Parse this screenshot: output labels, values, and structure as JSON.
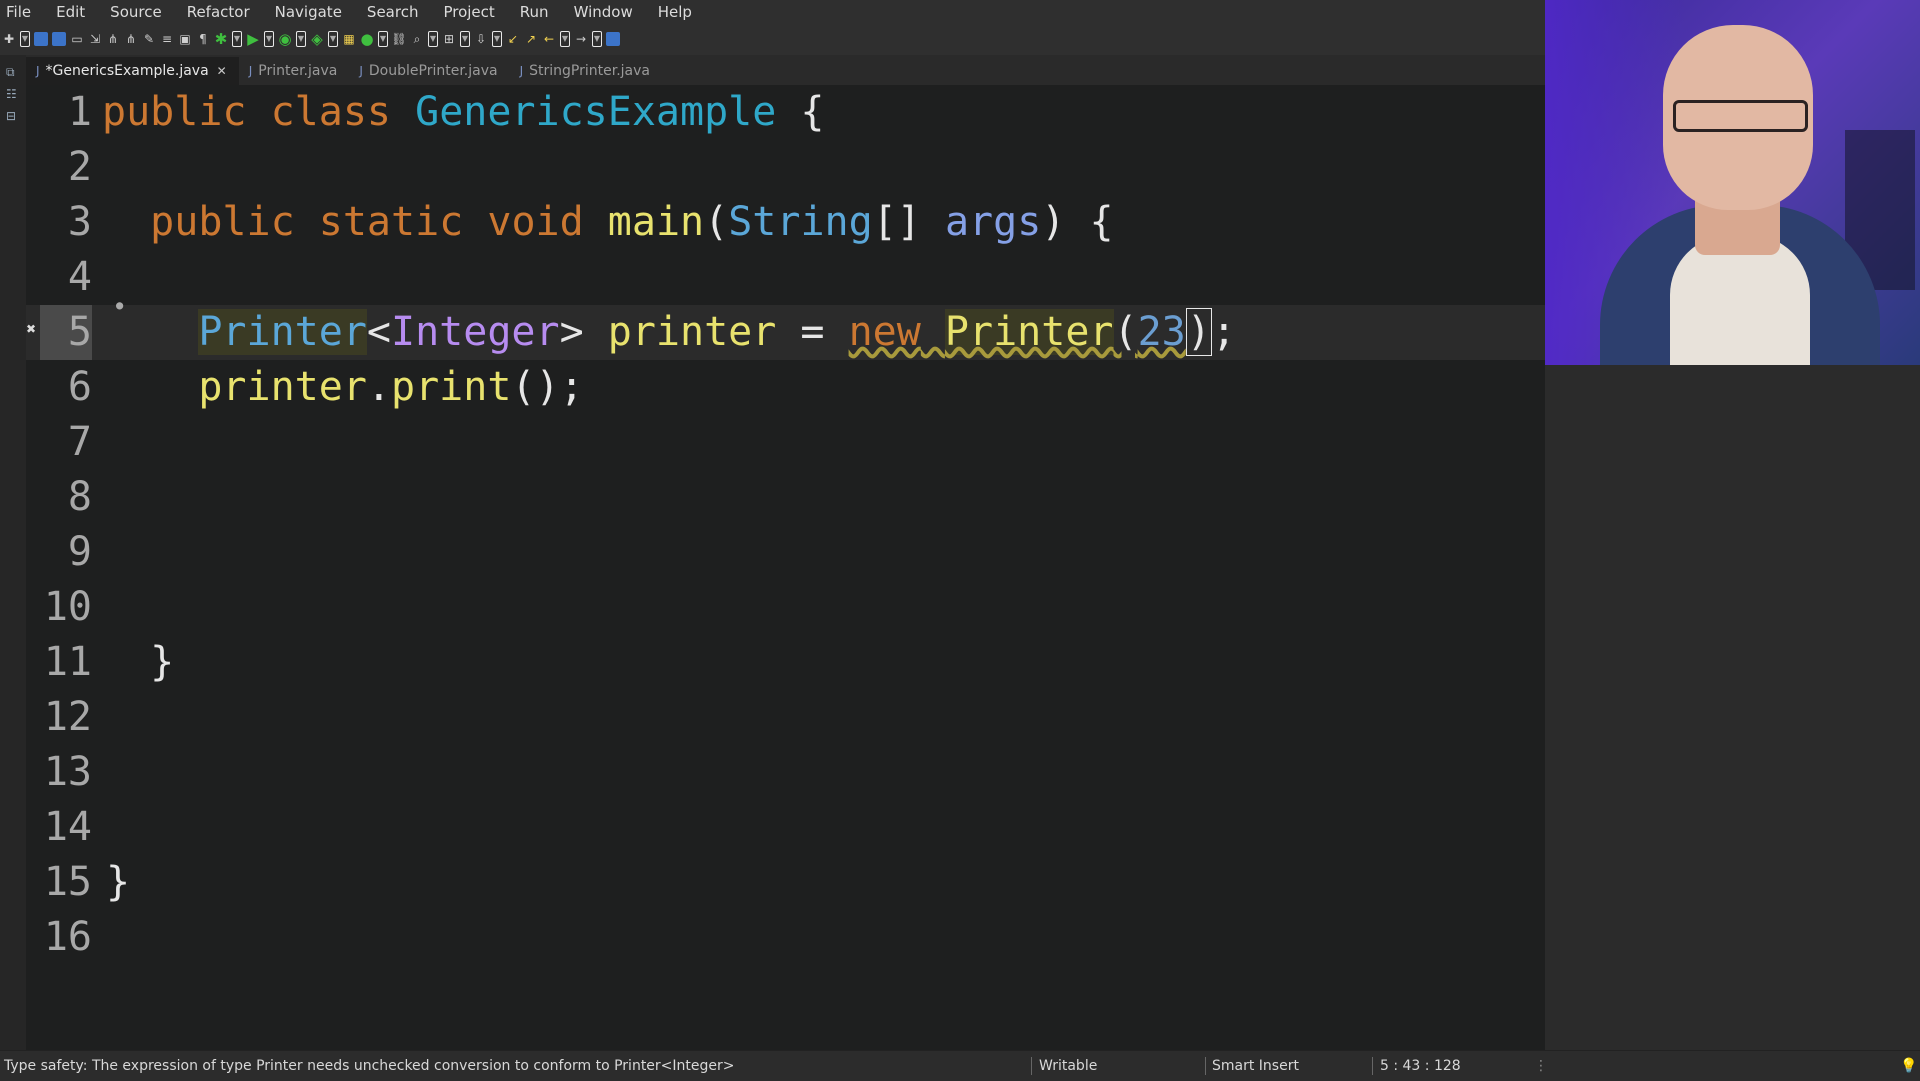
{
  "menu": [
    "File",
    "Edit",
    "Source",
    "Refactor",
    "Navigate",
    "Search",
    "Project",
    "Run",
    "Window",
    "Help"
  ],
  "tabs": [
    {
      "label": "*GenericsExample.java",
      "active": true,
      "closable": true
    },
    {
      "label": "Printer.java",
      "active": false
    },
    {
      "label": "DoublePrinter.java",
      "active": false
    },
    {
      "label": "StringPrinter.java",
      "active": false
    }
  ],
  "editor": {
    "line_numbers": [
      "1",
      "2",
      "3",
      "4",
      "5",
      "6",
      "7",
      "8",
      "9",
      "10",
      "11",
      "12",
      "13",
      "14",
      "15",
      "16"
    ],
    "current_line": "5",
    "code": {
      "l1": {
        "t1": "public",
        "t2": " ",
        "t3": "class",
        "t4": " ",
        "t5": "GenericsExample",
        "t6": " {"
      },
      "l3": {
        "indent": "  ",
        "t1": "public",
        "t2": " ",
        "t3": "static",
        "t4": " ",
        "t5": "void",
        "t6": " ",
        "t7": "main",
        "t8": "(",
        "t9": "String",
        "t10": "[] ",
        "t11": "args",
        "t12": ") {"
      },
      "l5": {
        "indent": "    ",
        "t1": "Printer",
        "t2": "<",
        "t3": "Integer",
        "t4": "> ",
        "t5": "printer",
        "t6": " = ",
        "t7": "new",
        "t8": " ",
        "t9": "Printer",
        "t10": "(",
        "t11": "23",
        "t12": ")",
        "t13": ";"
      },
      "l6": {
        "indent": "    ",
        "t1": "printer",
        "t2": ".",
        "t3": "print",
        "t4": "();"
      },
      "l11": {
        "indent": "  ",
        "t1": "}"
      },
      "l15": {
        "t1": "}"
      }
    }
  },
  "status": {
    "message": "Type safety: The expression of type Printer needs unchecked conversion to conform to Printer<Integer>",
    "writable": "Writable",
    "insert_mode": "Smart Insert",
    "position": "5 : 43 : 128"
  },
  "colors": {
    "keyword": "#cc7832",
    "class": "#2fa8c9",
    "method": "#e8e26e",
    "type": "#5ba7d8",
    "generic": "#b78cf0",
    "number": "#6b9ed1"
  },
  "icons": [
    "new-file-icon",
    "save-icon",
    "save-all-icon",
    "print-icon",
    "debug-icon",
    "run-icon",
    "coverage-icon",
    "external-tools-icon",
    "search-icon",
    "back-icon",
    "forward-icon",
    "perspective-icon",
    "lightbulb-icon"
  ]
}
